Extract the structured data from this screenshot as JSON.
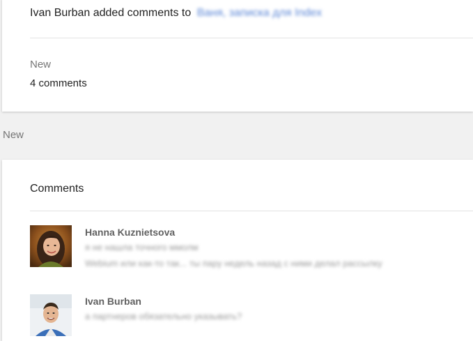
{
  "activity": {
    "actor": "Ivan Burban",
    "action_text": "added comments to",
    "target_link": "Ваня, записка для Index",
    "status": "New",
    "count_label": "4 comments"
  },
  "section_label": "New",
  "comments_panel": {
    "heading": "Comments",
    "items": [
      {
        "author": "Hanna Kuznietsova",
        "lines": [
          "я не нашла точного ммолм",
          "Webium или как-то так... ты пару недель назад с ними делал рассылку"
        ]
      },
      {
        "author": "Ivan Burban",
        "lines": [
          "а партнеров обязательно указывать?"
        ]
      }
    ]
  },
  "colors": {
    "link": "#5b86d6",
    "background": "#f1f1f1",
    "card": "#ffffff",
    "muted_text": "#757575"
  },
  "icons": {
    "avatar_1": "user-avatar-photo",
    "avatar_2": "user-avatar-photo"
  }
}
